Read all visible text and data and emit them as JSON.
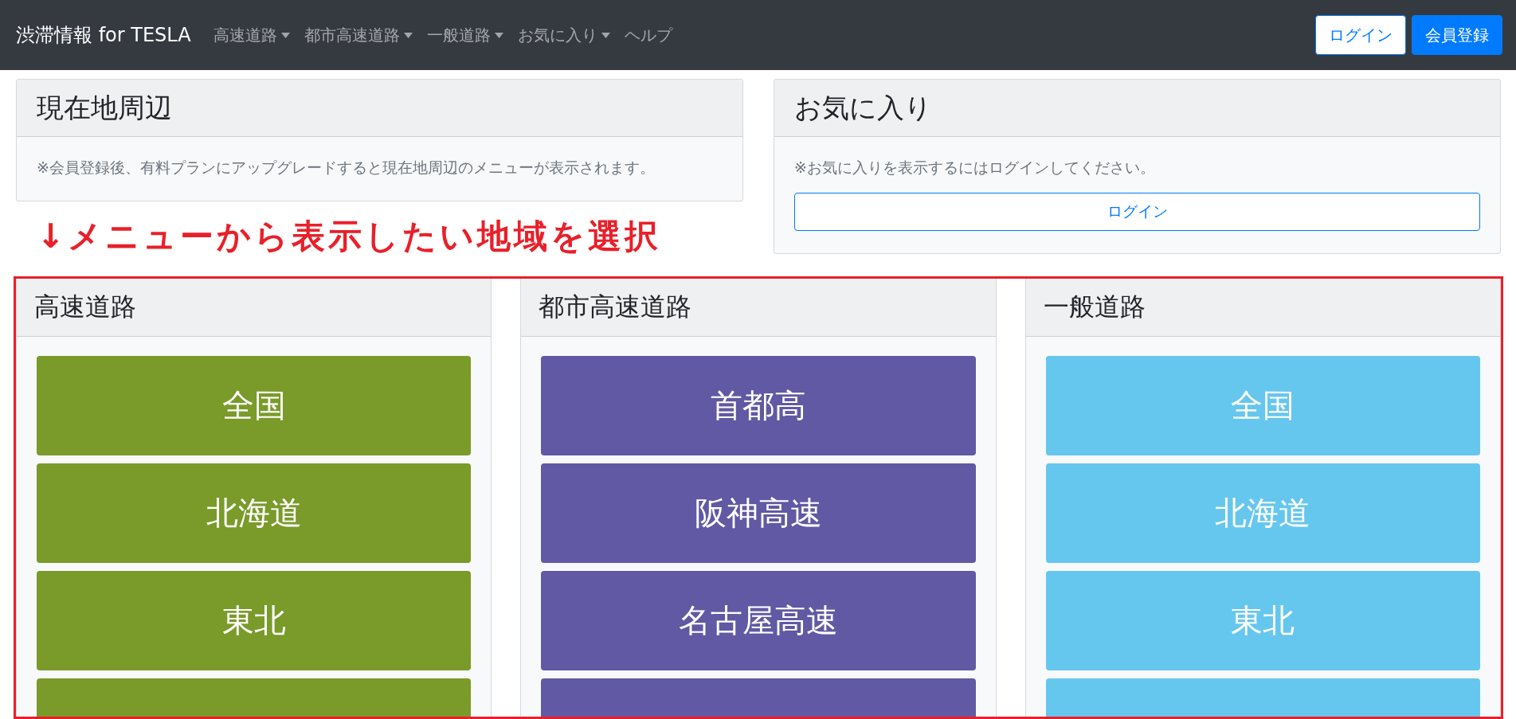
{
  "navbar": {
    "brand": "渋滞情報 for TESLA",
    "links": [
      {
        "label": "高速道路",
        "dropdown": true
      },
      {
        "label": "都市高速道路",
        "dropdown": true
      },
      {
        "label": "一般道路",
        "dropdown": true
      },
      {
        "label": "お気に入り",
        "dropdown": true
      },
      {
        "label": "ヘルプ",
        "dropdown": false
      }
    ],
    "buttons": [
      {
        "label": "ログイン",
        "kind": "outline"
      },
      {
        "label": "会員登録",
        "kind": "primary"
      }
    ]
  },
  "cards": [
    {
      "title": "現在地周辺",
      "text": "※会員登録後、有料プランにアップグレードすると現在地周辺のメニューが表示されます。"
    },
    {
      "title": "お気に入り",
      "text": "※お気に入りを表示するにはログインしてください。",
      "button": "ログイン"
    }
  ],
  "annotation": "↓メニューから表示したい地域を選択",
  "columns": [
    {
      "title": "高速道路",
      "color": "#7a9a2a",
      "items": [
        "全国",
        "北海道",
        "東北"
      ],
      "more_below": true
    },
    {
      "title": "都市高速道路",
      "color": "#6159a3",
      "items": [
        "首都高",
        "阪神高速",
        "名古屋高速"
      ],
      "more_below": true
    },
    {
      "title": "一般道路",
      "color": "#66c7ee",
      "items": [
        "全国",
        "北海道",
        "東北"
      ],
      "more_below": true
    }
  ]
}
